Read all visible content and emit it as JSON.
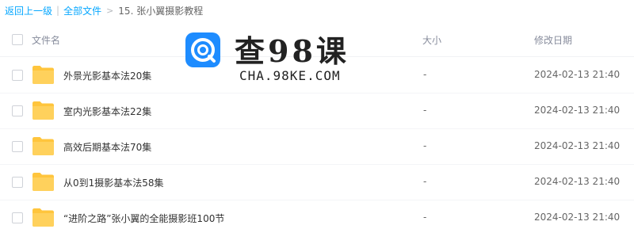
{
  "breadcrumb": {
    "back": "返回上一级",
    "all_files": "全部文件",
    "current": "15. 张小翼摄影教程"
  },
  "columns": {
    "name": "文件名",
    "size": "大小",
    "modified": "修改日期"
  },
  "files": [
    {
      "name": "外景光影基本法20集",
      "size": "-",
      "modified": "2024-02-13 21:40",
      "type": "folder"
    },
    {
      "name": "室内光影基本法22集",
      "size": "-",
      "modified": "2024-02-13 21:40",
      "type": "folder"
    },
    {
      "name": "高效后期基本法70集",
      "size": "-",
      "modified": "2024-02-13 21:40",
      "type": "folder"
    },
    {
      "name": "从0到1摄影基本法58集",
      "size": "-",
      "modified": "2024-02-13 21:40",
      "type": "folder"
    },
    {
      "name": "“进阶之路”张小翼的全能摄影班100节",
      "size": "-",
      "modified": "2024-02-13 21:40",
      "type": "folder"
    }
  ],
  "watermark": {
    "title": "查98课",
    "subtitle": "CHA.98KE.COM",
    "logo_icon": "chat-bubble-icon"
  },
  "colors": {
    "link": "#06a7ff",
    "folder": "#ffc53d",
    "watermark_logo": "#1e8cff"
  }
}
